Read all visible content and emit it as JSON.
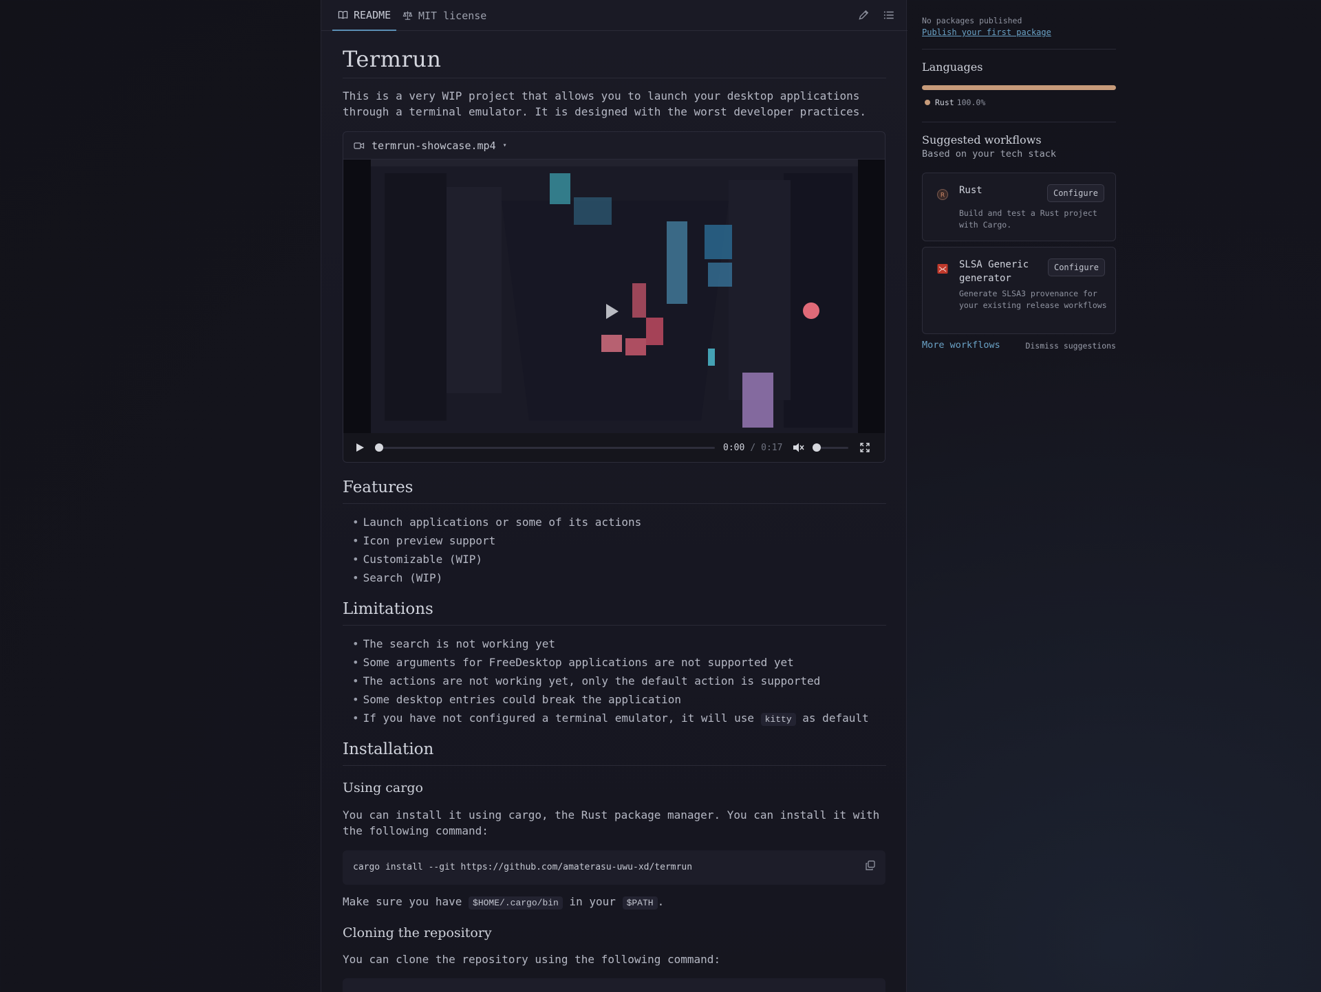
{
  "tabs": [
    {
      "label": "README",
      "icon": "book-icon",
      "active": true
    },
    {
      "label": "MIT license",
      "icon": "scale-icon",
      "active": false
    }
  ],
  "readme": {
    "title": "Termrun",
    "intro": "This is a very WIP project that allows you to launch your desktop applications through a terminal emulator. It is designed with the worst developer practices.",
    "video": {
      "filename": "termrun-showcase.mp4",
      "current_time": "0:00",
      "separator": "/",
      "duration": "0:17",
      "progress": 0.0,
      "volume": 0.0
    },
    "features_heading": "Features",
    "features": [
      "Launch applications or some of its actions",
      "Icon preview support",
      "Customizable (WIP)",
      "Search (WIP)"
    ],
    "limitations_heading": "Limitations",
    "limitations": [
      "The search is not working yet",
      "Some arguments for FreeDesktop applications are not supported yet",
      "The actions are not working yet, only the default action is supported",
      "Some desktop entries could break the application"
    ],
    "limitation_last": {
      "before": "If you have not configured a terminal emulator, it will use",
      "code": "kitty",
      "after": "as default"
    },
    "installation_heading": "Installation",
    "cargo_heading": "Using cargo",
    "cargo_text": "You can install it using cargo, the Rust package manager. You can install it with the following command:",
    "cargo_command": "cargo install --git https://github.com/amaterasu-uwu-xd/termrun",
    "path_note": {
      "before": "Make sure you have",
      "code1": "$HOME/.cargo/bin",
      "middle": "in your",
      "code2": "$PATH",
      "after": "."
    },
    "clone_heading": "Cloning the repository",
    "clone_text": "You can clone the repository using the following command:"
  },
  "sidebar": {
    "packages": {
      "status": "No packages published",
      "link": "Publish your first package"
    },
    "languages": {
      "heading": "Languages",
      "items": [
        {
          "name": "Rust",
          "percent": "100.0%",
          "share": 1.0,
          "color": "#c79b7a"
        }
      ]
    },
    "workflows": {
      "heading": "Suggested workflows",
      "subheading": "Based on your tech stack",
      "cards": [
        {
          "name": "Rust",
          "description": "Build and test a Rust project with Cargo.",
          "button": "Configure",
          "icon": "rust-icon"
        },
        {
          "name": "SLSA Generic generator",
          "description": "Generate SLSA3 provenance for your existing release workflows",
          "button": "Configure",
          "icon": "slsa-icon"
        }
      ],
      "more_link": "More workflows",
      "dismiss": "Dismiss suggestions"
    }
  }
}
